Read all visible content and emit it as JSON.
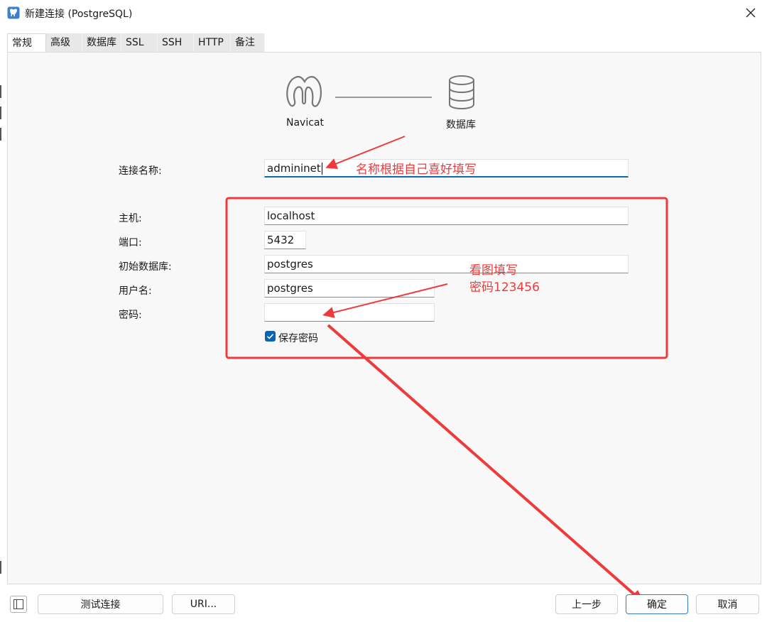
{
  "window": {
    "title": "新建连接 (PostgreSQL)",
    "app_icon": "postgresql-elephant-icon",
    "close_icon": "close-icon"
  },
  "tabs": [
    {
      "label": "常规",
      "active": true
    },
    {
      "label": "高级",
      "active": false
    },
    {
      "label": "数据库",
      "active": false
    },
    {
      "label": "SSL",
      "active": false
    },
    {
      "label": "SSH",
      "active": false
    },
    {
      "label": "HTTP",
      "active": false
    },
    {
      "label": "备注",
      "active": false
    }
  ],
  "diagram": {
    "left_label": "Navicat",
    "right_label": "数据库",
    "left_icon": "navicat-logo-icon",
    "right_icon": "database-icon"
  },
  "form": {
    "connection_name": {
      "label": "连接名称:",
      "value": "admininet"
    },
    "host": {
      "label": "主机:",
      "value": "localhost"
    },
    "port": {
      "label": "端口:",
      "value": "5432"
    },
    "initial_db": {
      "label": "初始数据库:",
      "value": "postgres"
    },
    "username": {
      "label": "用户名:",
      "value": "postgres"
    },
    "password": {
      "label": "密码:",
      "value": ""
    },
    "save_password": {
      "label": "保存密码",
      "checked": true
    }
  },
  "annotations": {
    "name_hint": "名称根据自己喜好填写",
    "fill_hint_line1": "看图填写",
    "fill_hint_line2": "密码123456",
    "color": "#ee3a3a"
  },
  "footer": {
    "test_connection": "测试连接",
    "uri": "URI...",
    "prev": "上一步",
    "ok": "确定",
    "cancel": "取消",
    "sidebar_toggle_icon": "sidebar-toggle-icon"
  },
  "colors": {
    "accent": "#0a64b4",
    "annotation_red": "#ee3a3a",
    "content_bg": "#f8f8f8"
  }
}
